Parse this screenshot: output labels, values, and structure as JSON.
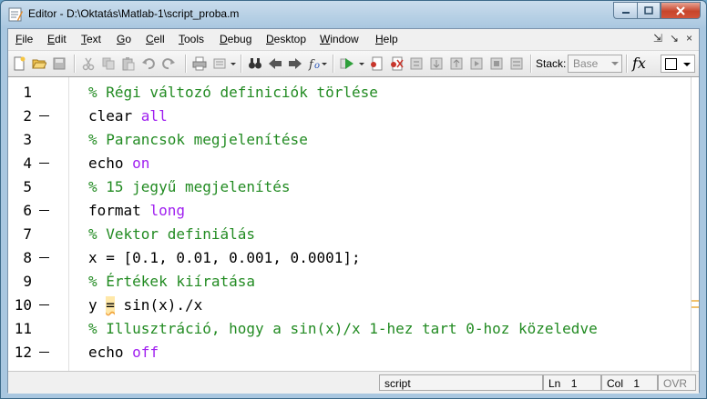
{
  "window": {
    "title": "Editor - D:\\Oktatás\\Matlab-1\\script_proba.m"
  },
  "menu": [
    "File",
    "Edit",
    "Text",
    "Go",
    "Cell",
    "Tools",
    "Debug",
    "Desktop",
    "Window",
    "Help"
  ],
  "menu_right": {
    "undock": "⇲",
    "dock": "↘",
    "close": "×"
  },
  "toolbar": {
    "stack_label": "Stack:",
    "stack_value": "Base",
    "fx_label": "fx"
  },
  "editor": {
    "lines": [
      {
        "n": "1",
        "bp": false,
        "segments": [
          {
            "t": "% Régi változó definiciók törlése",
            "c": "cmt"
          }
        ]
      },
      {
        "n": "2",
        "bp": true,
        "segments": [
          {
            "t": "clear ",
            "c": ""
          },
          {
            "t": "all",
            "c": "kw"
          }
        ]
      },
      {
        "n": "3",
        "bp": false,
        "segments": [
          {
            "t": "% Parancsok megjelenítése",
            "c": "cmt"
          }
        ]
      },
      {
        "n": "4",
        "bp": true,
        "segments": [
          {
            "t": "echo ",
            "c": ""
          },
          {
            "t": "on",
            "c": "kw"
          }
        ]
      },
      {
        "n": "5",
        "bp": false,
        "segments": [
          {
            "t": "% 15 jegyű megjelenítés",
            "c": "cmt"
          }
        ]
      },
      {
        "n": "6",
        "bp": true,
        "segments": [
          {
            "t": "format ",
            "c": ""
          },
          {
            "t": "long",
            "c": "kw"
          }
        ]
      },
      {
        "n": "7",
        "bp": false,
        "segments": [
          {
            "t": "% Vektor definiálás",
            "c": "cmt"
          }
        ]
      },
      {
        "n": "8",
        "bp": true,
        "segments": [
          {
            "t": "x = [0.1, 0.01, 0.001, 0.0001];",
            "c": ""
          }
        ]
      },
      {
        "n": "9",
        "bp": false,
        "segments": [
          {
            "t": "% Értékek kiíratása",
            "c": "cmt"
          }
        ]
      },
      {
        "n": "10",
        "bp": true,
        "segments": [
          {
            "t": "y ",
            "c": ""
          },
          {
            "t": "=",
            "c": "hl"
          },
          {
            "t": " sin(x)./x",
            "c": ""
          }
        ]
      },
      {
        "n": "11",
        "bp": false,
        "segments": [
          {
            "t": "% Illusztráció, hogy a sin(x)/x 1-hez tart 0-hoz közeledve",
            "c": "cmt"
          }
        ]
      },
      {
        "n": "12",
        "bp": true,
        "segments": [
          {
            "t": "echo ",
            "c": ""
          },
          {
            "t": "off",
            "c": "kw"
          }
        ]
      }
    ]
  },
  "status": {
    "mode": "script",
    "ln_label": "Ln",
    "ln_value": "1",
    "col_label": "Col",
    "col_value": "1",
    "ovr": "OVR"
  },
  "colors": {
    "comment": "#228b22",
    "keyword": "#a020f0",
    "warning": "#f1c16b"
  }
}
